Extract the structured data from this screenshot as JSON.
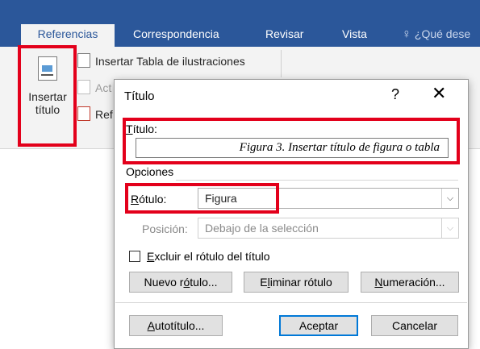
{
  "ribbon": {
    "tabs": [
      {
        "label": "Referencias"
      },
      {
        "label": "Correspondencia"
      },
      {
        "label": "Revisar"
      },
      {
        "label": "Vista"
      }
    ],
    "tell_me": "¿Qué dese",
    "insert_caption_label_1": "Insertar",
    "insert_caption_label_2": "título",
    "cmd_insert_table_figures": "Insertar Tabla de ilustraciones",
    "cmd_update_partial": "Act",
    "cmd_crossref_partial": "Ref"
  },
  "dialog": {
    "title": "Título",
    "help": "?",
    "close": "✕",
    "caption_label_pre": "T",
    "caption_label_post": "ítulo:",
    "caption_value": "Figura 3. Insertar título de figura o tabla",
    "options_label": "Opciones",
    "label_field_pre": "R",
    "label_field_post": "ótulo:",
    "label_value": "Figura",
    "position_label": "Posición:",
    "position_value": "Debajo de la selección",
    "exclude_pre": "E",
    "exclude_post": "xcluir el rótulo del título",
    "exclude_checked": false,
    "btn_new_pre": "Nuevo r",
    "btn_new_u": "ó",
    "btn_new_post": "tulo...",
    "btn_delete_pre": "E",
    "btn_delete_u": "l",
    "btn_delete_post": "iminar rótulo",
    "btn_numbering_u": "N",
    "btn_numbering_post": "umeración...",
    "btn_auto_u": "A",
    "btn_auto_post": "utotítulo...",
    "btn_ok": "Aceptar",
    "btn_cancel": "Cancelar"
  },
  "colors": {
    "highlight": "#e3001b",
    "ribbon": "#2b579a",
    "accent": "#0078d7"
  }
}
